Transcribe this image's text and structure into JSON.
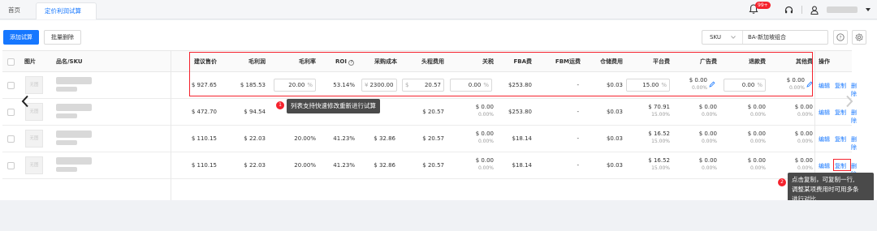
{
  "tabs": {
    "home": "首页",
    "active": "定价利润试算",
    "close": "×"
  },
  "notifications": {
    "badge": "99+"
  },
  "toolbar": {
    "add": "添加试算",
    "bulk_delete": "批量删除"
  },
  "filter": {
    "field": "SKU",
    "value": "BA-新加坡组合"
  },
  "columns": [
    "图片",
    "品名/SKU",
    "建议售价",
    "毛利润",
    "毛利率",
    "ROI",
    "采购成本",
    "头程费用",
    "关税",
    "FBA费",
    "FBM运费",
    "仓储费用",
    "平台费",
    "广告费",
    "退款费",
    "其他费",
    "操作"
  ],
  "rows": [
    {
      "thumb": "无图",
      "price": "$ 927.65",
      "profit": "$ 185.53",
      "margin_input": "20.00",
      "margin_unit": "%",
      "roi": "53.14%",
      "cost_prefix": "¥",
      "cost": "2300.00",
      "freight_prefix": "$",
      "freight": "20.57",
      "tariff": "0.00",
      "tariff_unit": "%",
      "fba": "$253.80",
      "fbm": "-",
      "storage": "$0.03",
      "platform": "15.00",
      "platform_unit": "%",
      "ads": "$ 0.00",
      "ads_sub": "0.00%",
      "refund": "0.00",
      "refund_unit": "%",
      "other": "$ 0.00",
      "other_sub": "0.00%"
    },
    {
      "thumb": "无图",
      "price": "$ 472.70",
      "profit": "$ 94.54",
      "margin": "",
      "roi": "",
      "cost": "",
      "freight": "$ 20.57",
      "tariff": "$ 0.00",
      "tariff_sub": "0.00%",
      "fba": "$253.80",
      "fbm": "-",
      "storage": "$0.03",
      "platform": "$ 70.91",
      "platform_sub": "15.00%",
      "ads": "$ 0.00",
      "ads_sub": "0.00%",
      "refund": "$ 0.00",
      "refund_sub": "0.00%",
      "other": "$ 0.00",
      "other_sub": "0.00%"
    },
    {
      "thumb": "无图",
      "price": "$ 110.15",
      "profit": "$ 22.03",
      "margin": "20.00%",
      "roi": "41.23%",
      "cost": "$ 32.86",
      "freight": "$ 20.57",
      "tariff": "$ 0.00",
      "tariff_sub": "0.00%",
      "fba": "$18.14",
      "fbm": "-",
      "storage": "$0.03",
      "platform": "$ 16.52",
      "platform_sub": "15.00%",
      "ads": "$ 0.00",
      "ads_sub": "0.00%",
      "refund": "$ 0.00",
      "refund_sub": "0.00%",
      "other": "$ 0.00",
      "other_sub": "0.00%"
    },
    {
      "thumb": "无图",
      "price": "$ 110.15",
      "profit": "$ 22.03",
      "margin": "20.00%",
      "roi": "41.23%",
      "cost": "$ 32.86",
      "freight": "$ 20.57",
      "tariff": "$ 0.00",
      "tariff_sub": "0.00%",
      "fba": "$18.14",
      "fbm": "-",
      "storage": "$0.03",
      "platform": "$ 16.52",
      "platform_sub": "15.00%",
      "ads": "$ 0.00",
      "ads_sub": "0.00%",
      "refund": "$ 0.00",
      "refund_sub": "0.00%",
      "other": "$ 0.00",
      "other_sub": "0.00%"
    }
  ],
  "ops": {
    "edit": "编辑",
    "copy": "复制",
    "delete": "删除"
  },
  "tips": {
    "one_num": "1",
    "one": "列表支持快速修改重新进行试算",
    "two_num": "2",
    "two_l1": "点击复制，可复制一行,",
    "two_l2": "调整某项费用时可用多条",
    "two_l3": "进行对比"
  },
  "icons": {
    "prev": "chevron-left-icon",
    "next": "chevron-right-icon",
    "bell": "bell-icon",
    "headset": "headset-icon",
    "user": "user-icon",
    "help": "help-icon",
    "settings": "gear-icon",
    "edit": "pencil-icon"
  },
  "colors": {
    "primary": "#1677ff",
    "alert": "#f5222d"
  }
}
